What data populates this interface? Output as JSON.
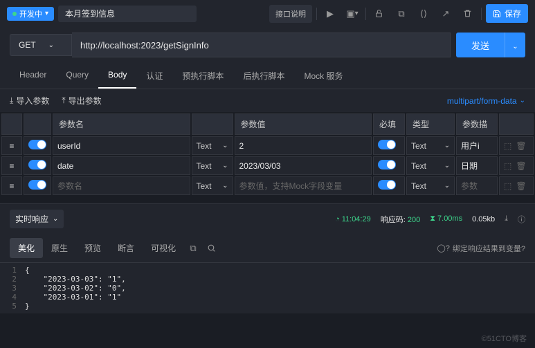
{
  "topbar": {
    "status": "开发中",
    "title": "本月签到信息",
    "api_desc": "接口说明",
    "save": "保存"
  },
  "request": {
    "method": "GET",
    "url": "http://localhost:2023/getSignInfo",
    "send": "发送"
  },
  "tabs": [
    "Header",
    "Query",
    "Body",
    "认证",
    "预执行脚本",
    "后执行脚本",
    "Mock 服务"
  ],
  "active_tab": "Body",
  "toolbar": {
    "import": "导入参数",
    "export": "导出参数",
    "content_type": "multipart/form-data"
  },
  "columns": {
    "name": "参数名",
    "value": "参数值",
    "required": "必填",
    "type": "类型",
    "desc": "参数描"
  },
  "type_label": "Text",
  "placeholders": {
    "name": "参数名",
    "value": "参数值，支持Mock字段变量",
    "desc": "参数"
  },
  "rows": [
    {
      "name": "userId",
      "value": "2",
      "desc": "用户i"
    },
    {
      "name": "date",
      "value": "2023/03/03",
      "desc": "日期"
    },
    {
      "name": "",
      "value": "",
      "desc": ""
    }
  ],
  "response": {
    "realtime": "实时响应",
    "time": "11:04:29",
    "status_label": "响应码:",
    "status_code": "200",
    "duration": "7.00ms",
    "size": "0.05kb",
    "tabs": [
      "美化",
      "原生",
      "预览",
      "断言",
      "可视化"
    ],
    "active": "美化",
    "bind_link": "绑定响应结果到变量?",
    "code_lines": [
      "{",
      "    \"2023-03-03\": \"1\",",
      "    \"2023-03-02\": \"0\",",
      "    \"2023-03-01\": \"1\"",
      "}"
    ]
  },
  "watermark": "©51CTO博客"
}
